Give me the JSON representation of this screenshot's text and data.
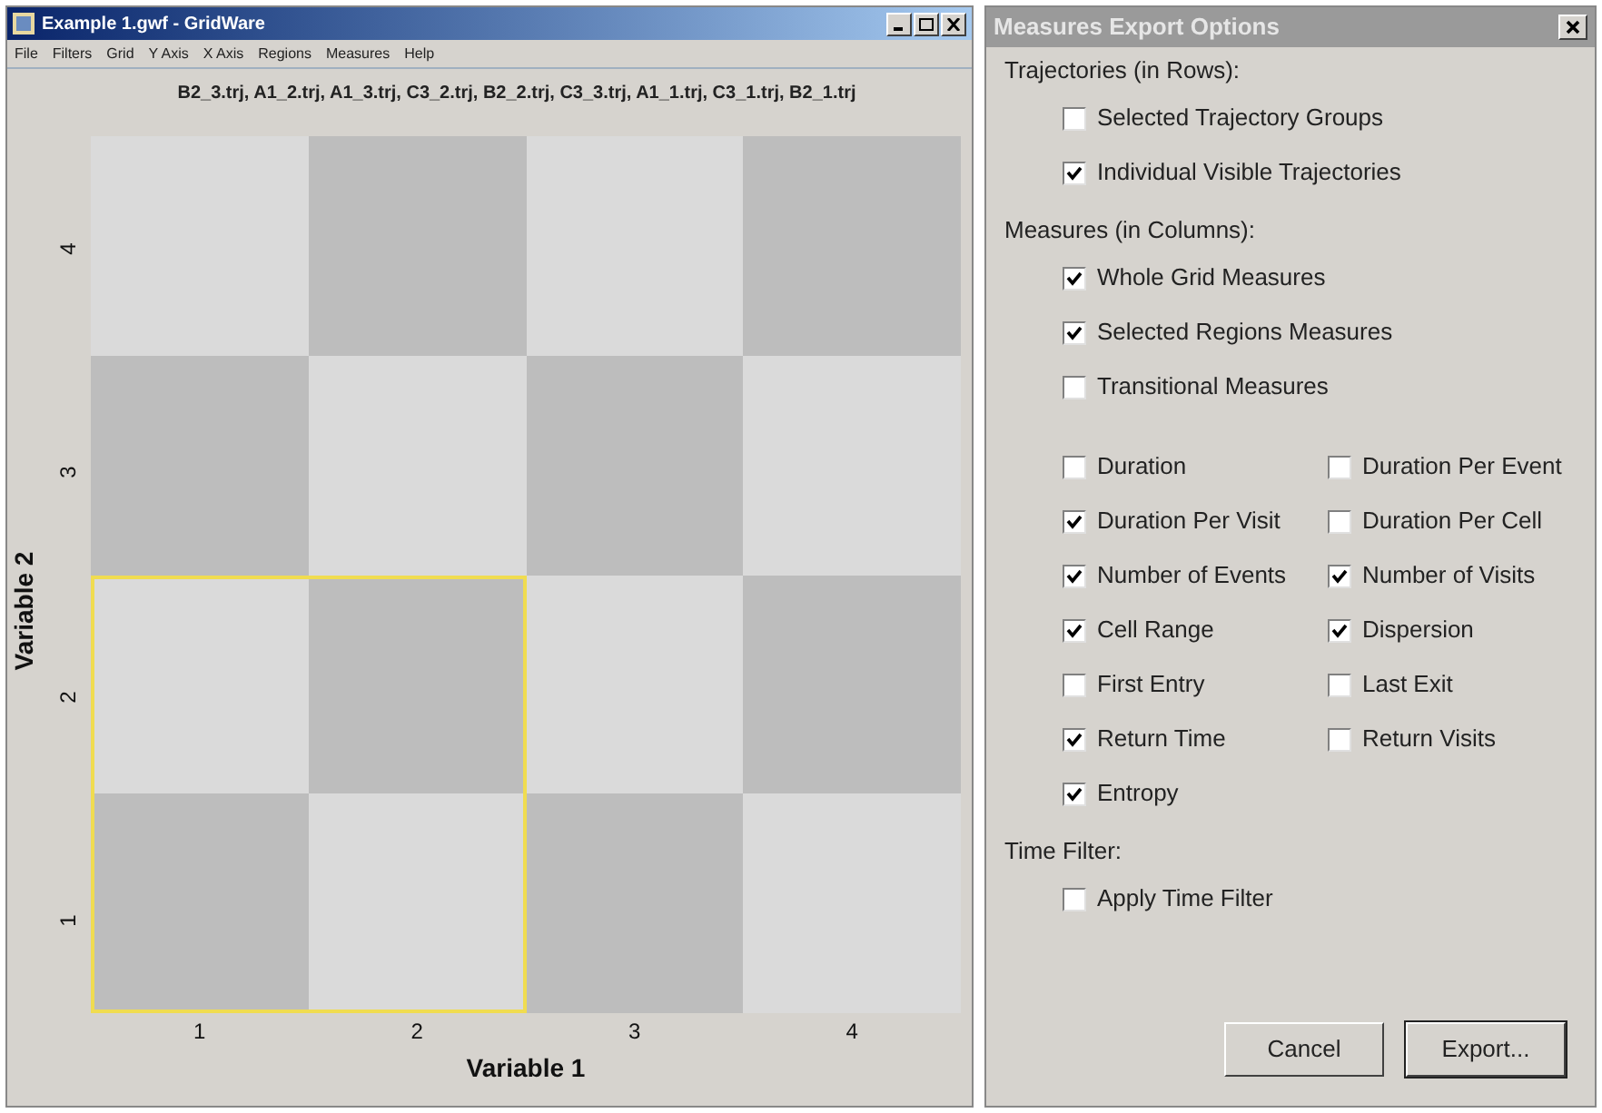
{
  "main_window": {
    "title": "Example 1.gwf - GridWare",
    "menu": [
      "File",
      "Filters",
      "Grid",
      "Y Axis",
      "X Axis",
      "Regions",
      "Measures",
      "Help"
    ],
    "files_label": "B2_3.trj, A1_2.trj, A1_3.trj, C3_2.trj, B2_2.trj, C3_3.trj, A1_1.trj, C3_1.trj, B2_1.trj",
    "grid": {
      "ylabel": "Variable 2",
      "xlabel": "Variable 1",
      "y_ticks": [
        "4",
        "3",
        "2",
        "1"
      ],
      "x_ticks": [
        "1",
        "2",
        "3",
        "4"
      ],
      "rows": [
        {
          "cells": [
            {
              "color": "#dadada",
              "selected": false
            },
            {
              "color": "#bdbdbd",
              "selected": false
            },
            {
              "color": "#dadada",
              "selected": false
            },
            {
              "color": "#bdbdbd",
              "selected": false
            }
          ]
        },
        {
          "cells": [
            {
              "color": "#bdbdbd",
              "selected": false
            },
            {
              "color": "#dadada",
              "selected": false
            },
            {
              "color": "#bdbdbd",
              "selected": false
            },
            {
              "color": "#dadada",
              "selected": false
            }
          ]
        },
        {
          "cells": [
            {
              "color": "#dadada",
              "selected": true
            },
            {
              "color": "#bdbdbd",
              "selected": true
            },
            {
              "color": "#dadada",
              "selected": false
            },
            {
              "color": "#bdbdbd",
              "selected": false
            }
          ]
        },
        {
          "cells": [
            {
              "color": "#bdbdbd",
              "selected": true
            },
            {
              "color": "#dadada",
              "selected": true
            },
            {
              "color": "#bdbdbd",
              "selected": false
            },
            {
              "color": "#dadada",
              "selected": false
            }
          ]
        }
      ]
    }
  },
  "dialog": {
    "title": "Measures Export Options",
    "sections": [
      {
        "heading": "Trajectories (in Rows):",
        "options": [
          {
            "label": "Selected Trajectory Groups",
            "checked": false
          },
          {
            "label": "Individual Visible Trajectories",
            "checked": true
          }
        ]
      },
      {
        "heading": "Measures (in Columns):",
        "options": [
          {
            "label": "Whole Grid Measures",
            "checked": true
          },
          {
            "label": "Selected Regions Measures",
            "checked": true
          },
          {
            "label": "Transitional Measures",
            "checked": false
          }
        ],
        "grid_options": [
          {
            "label": "Duration",
            "checked": false
          },
          {
            "label": "Duration Per Event",
            "checked": false
          },
          {
            "label": "Duration Per Visit",
            "checked": true
          },
          {
            "label": "Duration Per Cell",
            "checked": false
          },
          {
            "label": "Number of Events",
            "checked": true
          },
          {
            "label": "Number of Visits",
            "checked": true
          },
          {
            "label": "Cell Range",
            "checked": true
          },
          {
            "label": "Dispersion",
            "checked": true
          },
          {
            "label": "First Entry",
            "checked": false
          },
          {
            "label": "Last Exit",
            "checked": false
          },
          {
            "label": "Return Time",
            "checked": true
          },
          {
            "label": "Return Visits",
            "checked": false
          },
          {
            "label": "Entropy",
            "checked": true
          }
        ]
      },
      {
        "heading": "Time Filter:",
        "options": [
          {
            "label": "Apply Time Filter",
            "checked": false
          }
        ]
      }
    ],
    "buttons": [
      "Cancel",
      "Export..."
    ]
  }
}
